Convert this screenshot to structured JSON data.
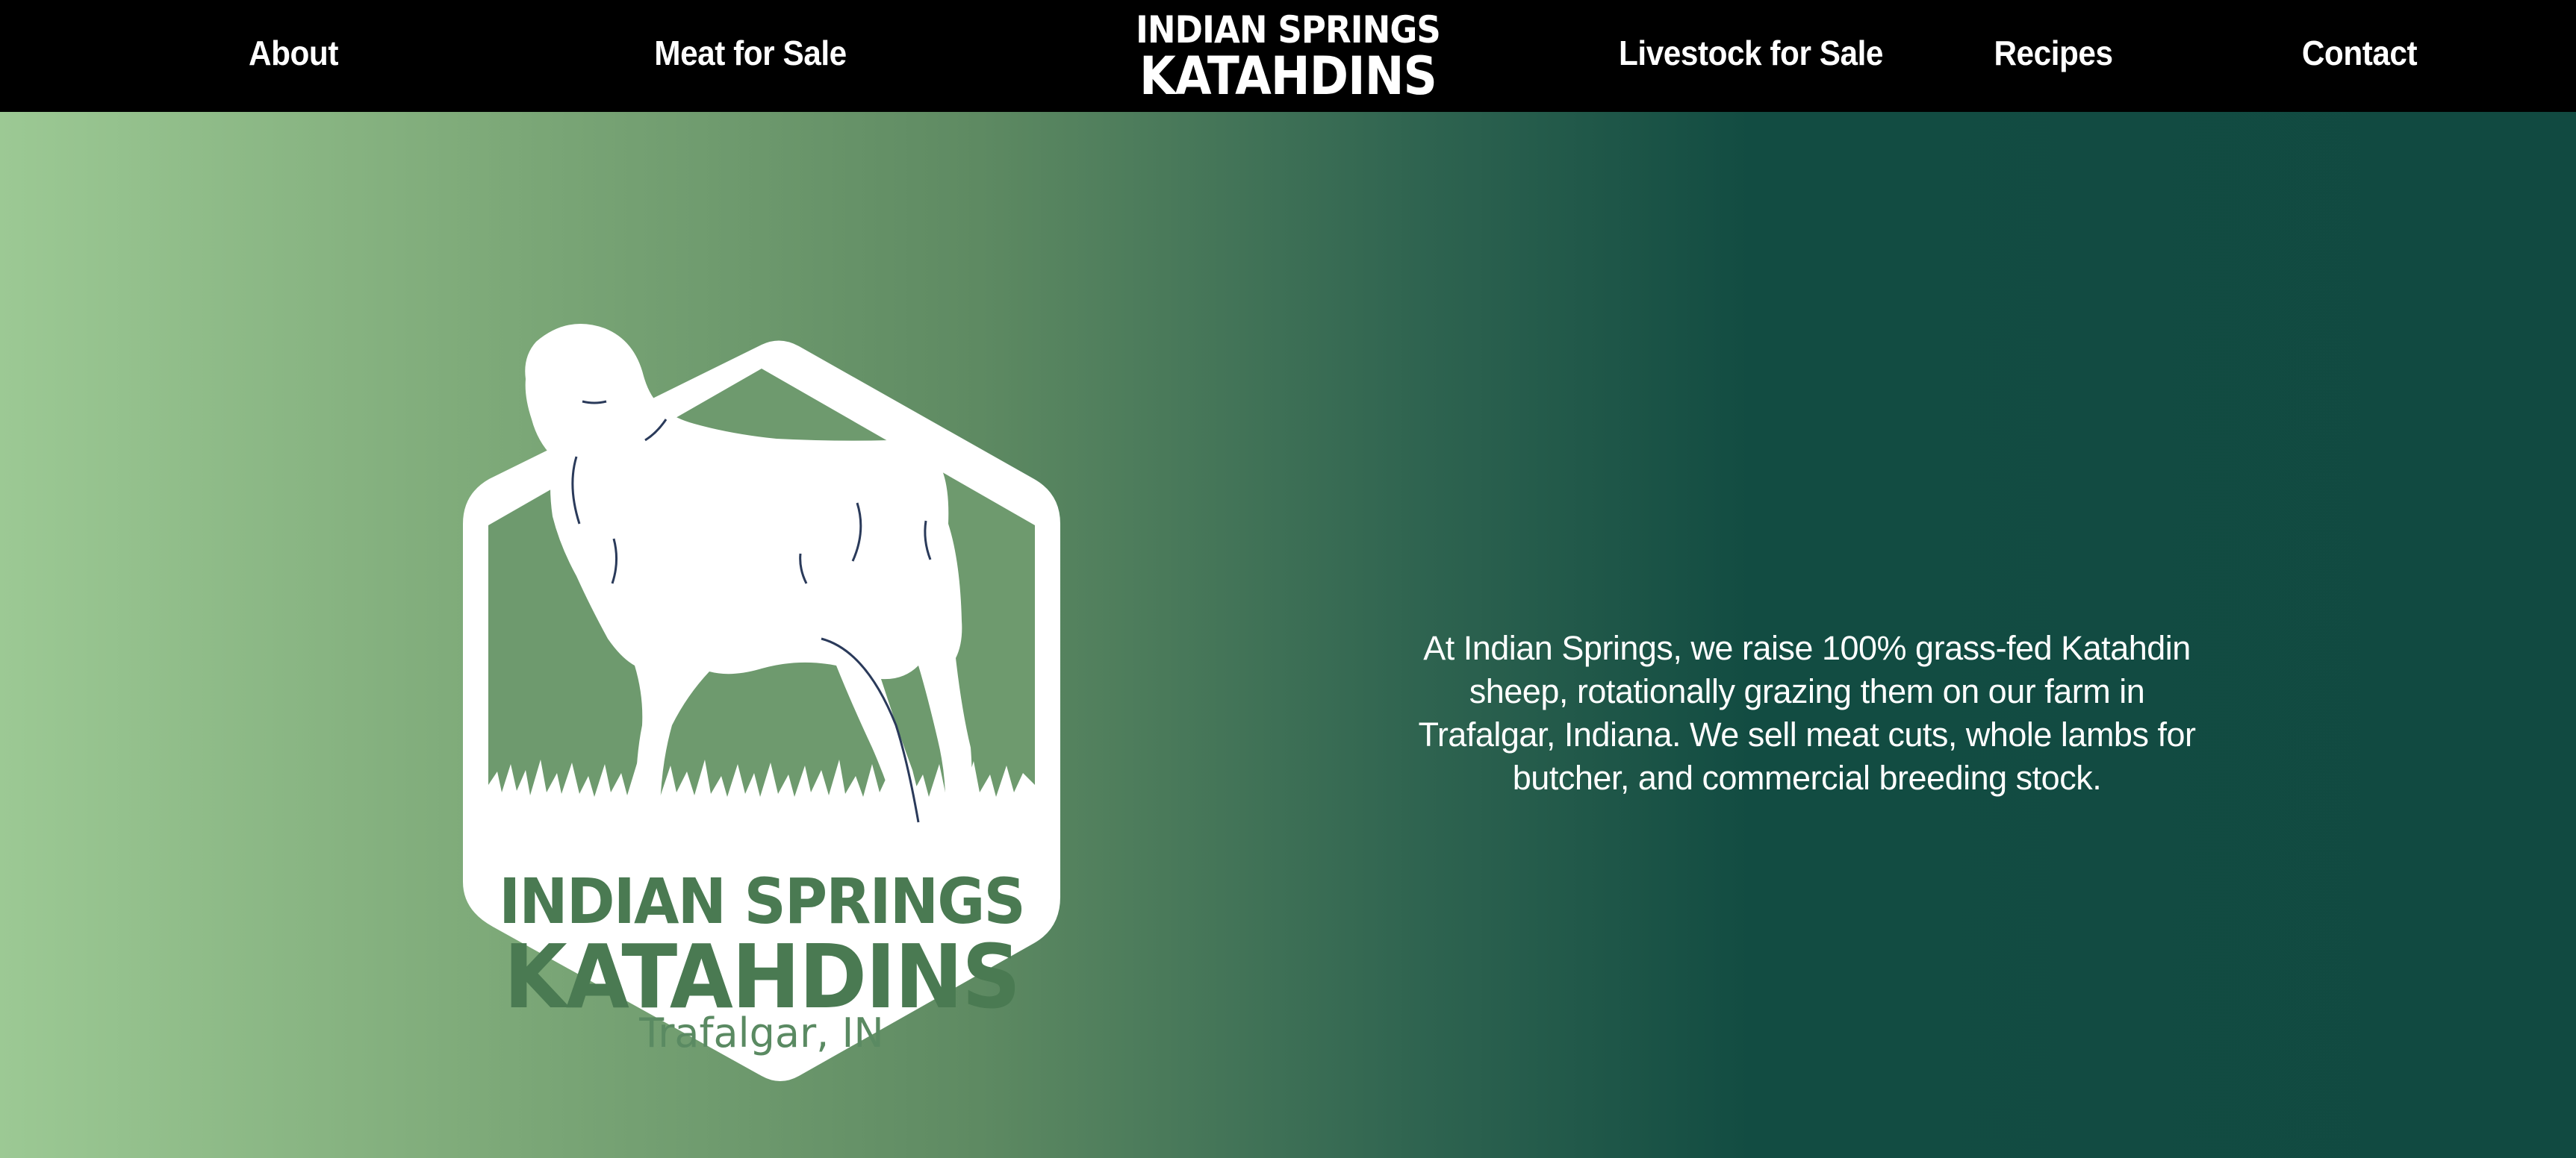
{
  "nav": {
    "about": "About",
    "meat_for_sale": "Meat for Sale",
    "brand_line1": "INDIAN SPRINGS",
    "brand_line2": "KATAHDINS",
    "livestock_for_sale": "Livestock for Sale",
    "recipes": "Recipes",
    "contact": "Contact"
  },
  "logo": {
    "line1": "INDIAN SPRINGS",
    "line2": "KATAHDINS",
    "location": "Trafalgar, IN",
    "icon": "sheep-hexagon-logo"
  },
  "intro": {
    "text": "At Indian Springs, we raise 100% grass-fed Katahdin sheep, rotationally grazing them on our farm in Trafalgar, Indiana. We sell meat cuts, whole lambs for butcher, and commercial breeding stock."
  },
  "colors": {
    "nav_bg": "#000000",
    "nav_text": "#ffffff",
    "gradient_left": "#9cc994",
    "gradient_right": "#114a41",
    "logo_fill": "#ffffff",
    "logo_text": "#4a7a52"
  }
}
